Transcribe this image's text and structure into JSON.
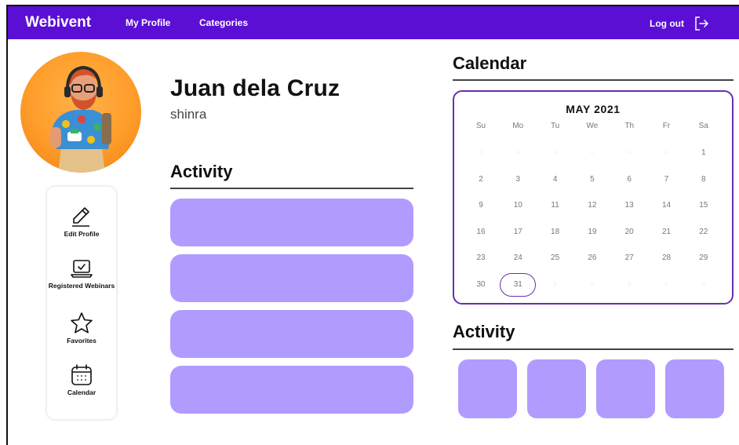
{
  "navbar": {
    "brand": "Webivent",
    "links": [
      "My Profile",
      "Categories"
    ],
    "logout_label": "Log out",
    "logout_icon": "logout-icon",
    "color": "#5b0fd4"
  },
  "profile": {
    "name": "Juan dela Cruz",
    "username": "shinra",
    "avatar_icon": "avatar-illustration"
  },
  "sidebar": {
    "items": [
      {
        "label": "Edit Profile",
        "icon": "pencil-icon"
      },
      {
        "label": "Registered Webinars",
        "icon": "laptop-check-icon"
      },
      {
        "label": "Favorites",
        "icon": "star-icon"
      },
      {
        "label": "Calendar",
        "icon": "calendar-icon"
      }
    ]
  },
  "activity_left": {
    "title": "Activity",
    "bar_color": "#b19bff"
  },
  "calendar": {
    "section_title": "Calendar",
    "month": "MAY 2021",
    "weekdays": [
      "Su",
      "Mo",
      "Tu",
      "We",
      "Th",
      "Fr",
      "Sa"
    ],
    "weeks": [
      [
        "",
        "",
        "",
        "",
        "",
        "",
        "1"
      ],
      [
        "2",
        "3",
        "4",
        "5",
        "6",
        "7",
        "8"
      ],
      [
        "9",
        "10",
        "11",
        "12",
        "13",
        "14",
        "15"
      ],
      [
        "16",
        "17",
        "18",
        "19",
        "20",
        "21",
        "22"
      ],
      [
        "23",
        "24",
        "25",
        "26",
        "27",
        "28",
        "29"
      ],
      [
        "30",
        "31",
        "",
        "",
        "",
        "",
        ""
      ]
    ],
    "selected_day": "31",
    "border_color": "#6a2fae"
  },
  "activity_right": {
    "title": "Activity",
    "tile_color": "#b19bff"
  }
}
